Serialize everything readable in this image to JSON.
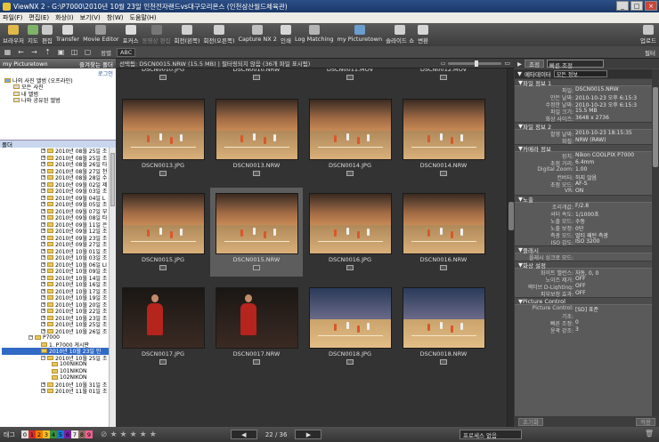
{
  "window": {
    "title": "ViewNX 2 - G:\\P7000\\2010년 10월 23일 인천전자랜드vs대구오리온스 (인천삼산월드체육관)"
  },
  "menu": [
    "파일(F)",
    "편집(E)",
    "화상(I)",
    "보기(V)",
    "창(W)",
    "도움말(H)"
  ],
  "toolbar": {
    "items": [
      {
        "label": "브라우저",
        "icon": "browser-icon",
        "color": "#e1b94a"
      },
      {
        "label": "지도",
        "icon": "map-icon",
        "color": "#7fb36a"
      },
      {
        "label": "편집",
        "icon": "edit-icon",
        "color": "#c9c9c9"
      },
      {
        "label": "Transfer",
        "icon": "transfer-icon",
        "color": "#d8d8d8"
      },
      {
        "label": "Movie Editor",
        "icon": "movie-icon",
        "color": "#9a9a9a"
      },
      {
        "label": "포커스",
        "icon": "focus-icon",
        "color": "#dcdcdc"
      },
      {
        "label": "동영상 편집",
        "icon": "movie-edit-icon",
        "color": "#777777",
        "dim": true
      },
      {
        "label": "회전(왼쪽)",
        "icon": "rotate-left-icon",
        "color": "#d0d0d0"
      },
      {
        "label": "회전(오른쪽)",
        "icon": "rotate-right-icon",
        "color": "#d0d0d0"
      },
      {
        "label": "Capture NX 2",
        "icon": "capture-icon",
        "color": "#bfbfbf"
      },
      {
        "label": "인쇄",
        "icon": "print-icon",
        "color": "#d6d6d6"
      },
      {
        "label": "Log Matching",
        "icon": "log-icon",
        "color": "#b5b5b5"
      },
      {
        "label": "my Picturetown",
        "icon": "picturetown-icon",
        "color": "#6a9ed0"
      },
      {
        "label": "슬라이드 쇼",
        "icon": "slideshow-icon",
        "color": "#d0d0d0"
      },
      {
        "label": "변환",
        "icon": "convert-icon",
        "color": "#d6d6d6"
      }
    ],
    "upload_label": "업로드"
  },
  "toolbar2": {
    "sort_label": "정렬",
    "sort_value": "ABC",
    "filter_label": "필터"
  },
  "left": {
    "tab_label": "my Picturetown",
    "fav_label": "즐겨찾는 폴더",
    "login_label": "로그인",
    "tree": [
      "나의 사진 앨범 (오프라인)",
      "모든 사진",
      "내 앨범",
      "나와 공유된 앨범"
    ],
    "folders_header": "폴더",
    "folders": [
      "2010년 08월 25일 조",
      "2010년 08월 25일 조",
      "2010년 08월 26일 타",
      "2010년 08월 27일 천",
      "2010년 08월 28일 수",
      "2010년 09월 02일 제",
      "2010년 09월 03일 조",
      "2010년 09월 04일 L",
      "2010년 09월 05일 조",
      "2010년 09월 07일 부",
      "2010년 09월 08일 타",
      "2010년 09월 11일 은",
      "2010년 09월 12일 조",
      "2010년 09월 23일 조",
      "2010년 09월 27일 조",
      "2010년 10월 01일 조",
      "2010년 10월 03일 조",
      "2010년 10월 06일 LI",
      "2010년 10월 09일 조",
      "2010년 10월 14일 조",
      "2010년 10월 16일 조",
      "2010년 10월 17일 조",
      "2010년 10월 19일 조",
      "2010년 10월 20일 조",
      "2010년 10월 22일 조",
      "2010년 10월 23일 조",
      "2010년 10월 25일 조",
      "2010년 10월 26일 조"
    ],
    "p7000": "P7000",
    "p7000_children": [
      "1. P7000 게시판",
      "2010년 10월 23일 인",
      "2010년 10월 25일 조"
    ],
    "nikon": [
      "100NIKON",
      "101NIKON",
      "102NIKON"
    ],
    "after_nikon": [
      "2010년 10월 31일 조",
      "2010년 11월 01일 조"
    ]
  },
  "center": {
    "status": "선택됨: DSCN0015.NRW (15.5 MB) | 필터링되지 않음 (36개 파일 표시됨)",
    "rows": [
      [
        "DSCN0010.JPG",
        "DSCN0010.NRW",
        "DSCN0011.MOV",
        "DSCN0012.MOV"
      ],
      [
        "DSCN0013.JPG",
        "DSCN0013.NRW",
        "DSCN0014.JPG",
        "DSCN0014.NRW"
      ],
      [
        "DSCN0015.JPG",
        "DSCN0015.NRW",
        "DSCN0016.JPG",
        "DSCN0016.NRW"
      ],
      [
        "DSCN0017.JPG",
        "DSCN0017.NRW",
        "DSCN0018.JPG",
        "DSCN0018.NRW"
      ]
    ]
  },
  "right": {
    "tab_adjust": "조정",
    "tab_sel": "빠른 조정",
    "meta_label": "메타데이터",
    "meta_sel": "모든 정보",
    "sections": [
      {
        "title": "파일 정보 1",
        "rows": [
          [
            "파일:",
            "DSCN0015.NRW"
          ],
          [
            "만든 날짜:",
            "2010-10-23 오후 6:15:3"
          ],
          [
            "수정한 날짜:",
            "2010-10-23 오후 6:15:3"
          ],
          [
            "파일 크기:",
            "15.5 MB"
          ],
          [
            "화상 사이즈:",
            "3648 x 2736"
          ]
        ]
      },
      {
        "title": "파일 정보 2",
        "rows": [
          [
            "촬영 날짜:",
            "2010-10-23 18:15:35"
          ],
          [
            "화질:",
            "NRW (RAW)"
          ]
        ]
      },
      {
        "title": "카메라 정보",
        "rows": [
          [
            "장치:",
            "Nikon COOLPIX P7000"
          ],
          [
            "초점 거리:",
            "6.4mm"
          ],
          [
            "Digital Zoom:",
            "1.00"
          ],
          [
            "컨버터:",
            "하지 않음"
          ],
          [
            "초점 모드:",
            "AF-S"
          ],
          [
            "VR:",
            "ON"
          ]
        ]
      },
      {
        "title": "노출",
        "rows": [
          [
            "조리개값:",
            "F/2.8"
          ],
          [
            "셔터 속도:",
            "1/1000초"
          ],
          [
            "노출 모드:",
            "수동"
          ],
          [
            "노출 보정:",
            "0단"
          ],
          [
            "측광 모드:",
            "멀티 패턴 측광"
          ],
          [
            "ISO 감도:",
            "ISO 3200"
          ]
        ]
      },
      {
        "title": "플래시",
        "rows": [
          [
            "플래시 싱크로 모드:",
            ""
          ]
        ]
      },
      {
        "title": "화상 설정",
        "rows": [
          [
            "화이트 밸런스:",
            "자동, 0, 0"
          ],
          [
            "노이즈 제거:",
            "OFF"
          ],
          [
            "액티브 D-Lighting:",
            "OFF"
          ],
          [
            "피부보정 효과:",
            "OFF"
          ]
        ]
      },
      {
        "title": "Picture Control",
        "rows": [
          [
            "Picture Control:",
            "[SD] 표준"
          ],
          [
            "기초:",
            ""
          ],
          [
            "빠른 조정:",
            "0"
          ],
          [
            "윤곽 강조:",
            "3"
          ]
        ]
      }
    ],
    "foot_reset": "초기화",
    "foot_apply": "적용"
  },
  "bottom": {
    "tag_label": "태그",
    "labels": [
      "0",
      "1",
      "2",
      "3",
      "4",
      "5",
      "6",
      "7",
      "8",
      "9"
    ],
    "label_colors": [
      "#dcdcdc",
      "#d32f2f",
      "#f57c00",
      "#fbc02d",
      "#388e3c",
      "#1976d2",
      "#7b1fa2",
      "#e8e8e8",
      "#8d6e63",
      "#f06292"
    ],
    "page": "22 / 36",
    "process_label": "프로세스 없음"
  }
}
